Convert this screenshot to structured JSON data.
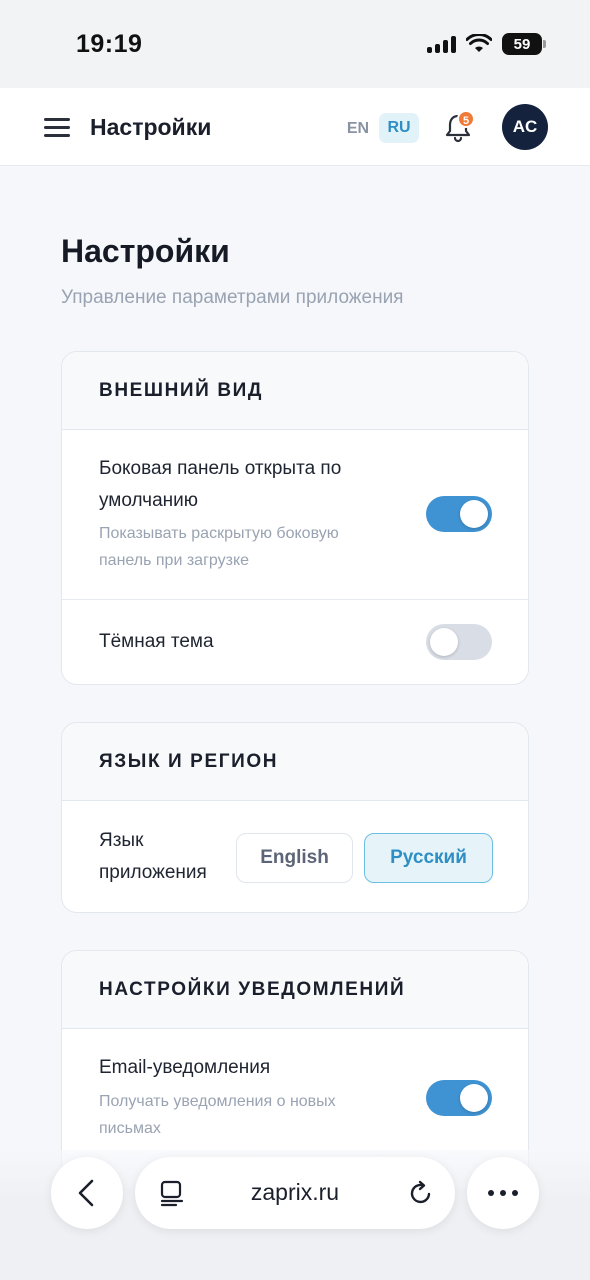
{
  "status_bar": {
    "time": "19:19",
    "battery": "59"
  },
  "appbar": {
    "title": "Настройки",
    "lang_en": "EN",
    "lang_ru": "RU",
    "notification_count": "5",
    "avatar_initials": "AC"
  },
  "page": {
    "title": "Настройки",
    "subtitle": "Управление параметрами приложения"
  },
  "appearance": {
    "header": "ВНЕШНИЙ ВИД",
    "sidebar_label_line1": "Боковая панель открыта по",
    "sidebar_label_line2": "умолчанию",
    "sidebar_desc_line1": "Показывать раскрытую боковую",
    "sidebar_desc_line2": "панель при загрузке",
    "sidebar_on": true,
    "dark_label": "Тёмная тема",
    "dark_on": false
  },
  "language": {
    "header": "ЯЗЫК И РЕГИОН",
    "label_line1": "Язык",
    "label_line2": "приложения",
    "option_en": "English",
    "option_ru": "Русский",
    "selected": "Русский"
  },
  "notifications": {
    "header": "НАСТРОЙКИ УВЕДОМЛЕНИЙ",
    "email_label": "Email-уведомления",
    "email_desc_line1": "Получать уведомления о новых",
    "email_desc_line2": "письмах",
    "email_on": true
  },
  "browser": {
    "url": "zaprix.ru"
  },
  "colors": {
    "accent": "#3f93d3",
    "avatar_bg": "#14223d",
    "badge": "#f07a36"
  }
}
